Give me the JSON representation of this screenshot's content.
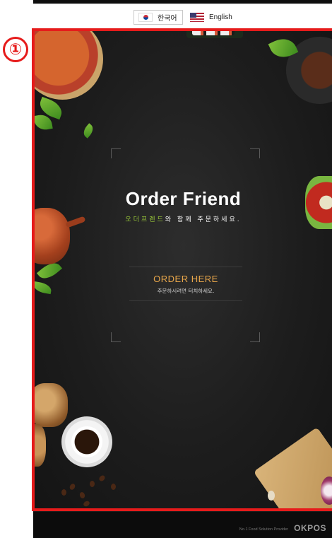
{
  "language_bar": {
    "korean_label": "한국어",
    "english_label": "English"
  },
  "annotation": {
    "marker_label": "①",
    "highlight_color": "#e61b1b"
  },
  "splash": {
    "title": "Order Friend",
    "subtitle_accent": "오더프렌드",
    "subtitle_rest": "와 함께 주문하세요.",
    "order_button_label": "ORDER HERE",
    "order_button_hint": "주문하시려면 터치하세요.",
    "accent_color": "#9ccc3a",
    "button_color": "#e8a64a"
  },
  "footer": {
    "tagline": "No.1 Food Solution Provider",
    "logo_text": "OKPOS"
  }
}
